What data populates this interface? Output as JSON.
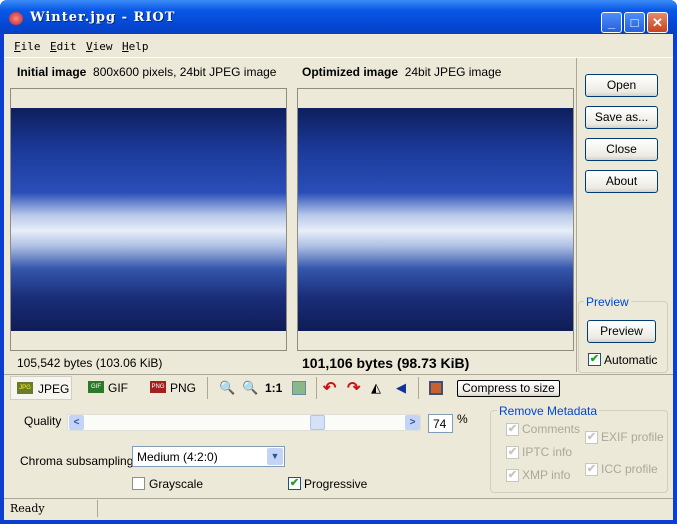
{
  "window": {
    "title": "Winter.jpg - RIOT",
    "icon": "riot-app-icon",
    "controls": [
      "minimize",
      "maximize",
      "close"
    ]
  },
  "menu": [
    {
      "label": "File",
      "key": "F",
      "rest": "ile"
    },
    {
      "label": "Edit",
      "key": "E",
      "rest": "dit"
    },
    {
      "label": "View",
      "key": "V",
      "rest": "iew"
    },
    {
      "label": "Help",
      "key": "H",
      "rest": "elp"
    }
  ],
  "initial": {
    "title": "Initial image",
    "info": "800x600 pixels, 24bit JPEG image",
    "size": "105,542 bytes (103.06 KiB)"
  },
  "optimized": {
    "title": "Optimized image",
    "info": "24bit JPEG image",
    "size": "101,106 bytes (98.73 KiB)"
  },
  "sidebar": {
    "open": "Open",
    "save_as": "Save as...",
    "close": "Close",
    "about": "About",
    "preview_group": "Preview",
    "preview": "Preview",
    "automatic": "Automatic",
    "automatic_checked": true
  },
  "tabs": [
    {
      "label": "JPEG",
      "icon": "jpg-icon",
      "active": true
    },
    {
      "label": "GIF",
      "icon": "gif-icon"
    },
    {
      "label": "PNG",
      "icon": "png-icon"
    }
  ],
  "toolbar": {
    "zoom_1_1": "1:1",
    "compress_to_size": "Compress to size",
    "icons": [
      "zoom-in-icon",
      "zoom-out-icon",
      "fit-image-icon",
      "rotate-left-icon",
      "rotate-right-icon",
      "flip-horizontal-icon",
      "flip-vertical-icon",
      "batch-icon"
    ]
  },
  "jpeg": {
    "quality_label": "Quality",
    "quality": 74,
    "quality_unit": "%",
    "chroma_label": "Chroma subsampling",
    "chroma_value": "Medium (4:2:0)",
    "grayscale": "Grayscale",
    "grayscale_checked": false,
    "progressive": "Progressive",
    "progressive_checked": true
  },
  "metadata": {
    "title": "Remove Metadata",
    "comments": "Comments",
    "iptc": "IPTC info",
    "xmp": "XMP info",
    "exif": "EXIF profile",
    "icc": "ICC profile"
  },
  "status": "Ready",
  "colors": {
    "titlebar": "#0a58e6",
    "face": "#ece9d8",
    "group_title": "#0046d5"
  }
}
